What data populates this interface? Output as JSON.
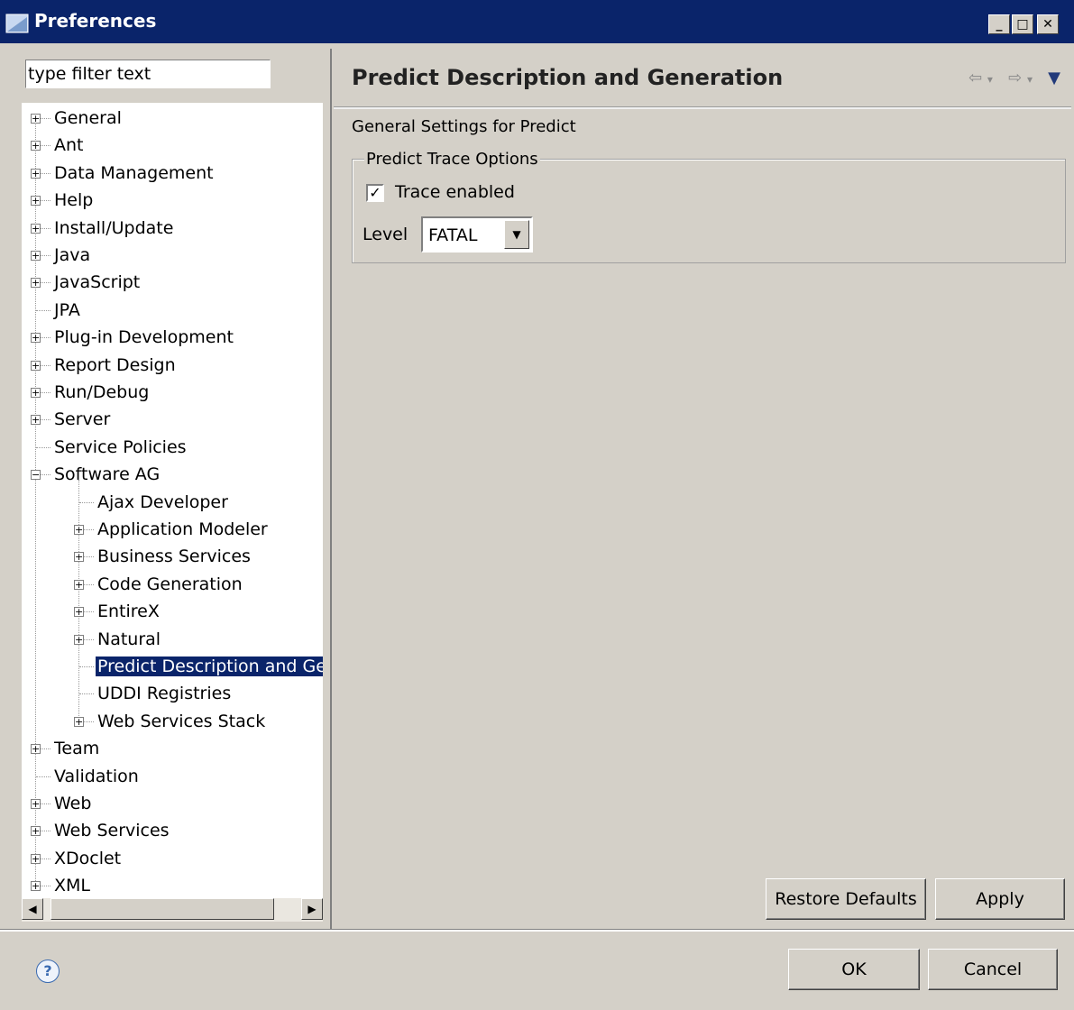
{
  "window": {
    "title": "Preferences"
  },
  "filter": {
    "placeholder": "type filter text",
    "value": "type filter text"
  },
  "tree": [
    {
      "label": "General",
      "expandable": true,
      "expanded": false,
      "level": 0
    },
    {
      "label": "Ant",
      "expandable": true,
      "expanded": false,
      "level": 0
    },
    {
      "label": "Data Management",
      "expandable": true,
      "expanded": false,
      "level": 0
    },
    {
      "label": "Help",
      "expandable": true,
      "expanded": false,
      "level": 0
    },
    {
      "label": "Install/Update",
      "expandable": true,
      "expanded": false,
      "level": 0
    },
    {
      "label": "Java",
      "expandable": true,
      "expanded": false,
      "level": 0
    },
    {
      "label": "JavaScript",
      "expandable": true,
      "expanded": false,
      "level": 0
    },
    {
      "label": "JPA",
      "expandable": false,
      "level": 0
    },
    {
      "label": "Plug-in Development",
      "expandable": true,
      "expanded": false,
      "level": 0
    },
    {
      "label": "Report Design",
      "expandable": true,
      "expanded": false,
      "level": 0
    },
    {
      "label": "Run/Debug",
      "expandable": true,
      "expanded": false,
      "level": 0
    },
    {
      "label": "Server",
      "expandable": true,
      "expanded": false,
      "level": 0
    },
    {
      "label": "Service Policies",
      "expandable": false,
      "level": 0
    },
    {
      "label": "Software AG",
      "expandable": true,
      "expanded": true,
      "level": 0
    },
    {
      "label": "Ajax Developer",
      "expandable": false,
      "level": 1
    },
    {
      "label": "Application Modeler",
      "expandable": true,
      "expanded": false,
      "level": 1
    },
    {
      "label": "Business Services",
      "expandable": true,
      "expanded": false,
      "level": 1
    },
    {
      "label": "Code Generation",
      "expandable": true,
      "expanded": false,
      "level": 1
    },
    {
      "label": "EntireX",
      "expandable": true,
      "expanded": false,
      "level": 1
    },
    {
      "label": "Natural",
      "expandable": true,
      "expanded": false,
      "level": 1
    },
    {
      "label": "Predict Description and Ger",
      "expandable": false,
      "level": 1,
      "selected": true
    },
    {
      "label": "UDDI Registries",
      "expandable": false,
      "level": 1
    },
    {
      "label": "Web Services Stack",
      "expandable": true,
      "expanded": false,
      "level": 1
    },
    {
      "label": "Team",
      "expandable": true,
      "expanded": false,
      "level": 0
    },
    {
      "label": "Validation",
      "expandable": false,
      "level": 0
    },
    {
      "label": "Web",
      "expandable": true,
      "expanded": false,
      "level": 0
    },
    {
      "label": "Web Services",
      "expandable": true,
      "expanded": false,
      "level": 0
    },
    {
      "label": "XDoclet",
      "expandable": true,
      "expanded": false,
      "level": 0
    },
    {
      "label": "XML",
      "expandable": true,
      "expanded": false,
      "level": 0
    }
  ],
  "page": {
    "title": "Predict Description and Generation",
    "section_title": "General Settings for Predict",
    "group_label": "Predict Trace Options",
    "trace_label": "Trace enabled",
    "trace_checked": true,
    "level_label": "Level",
    "level_value": "FATAL",
    "restore_defaults": "Restore Defaults",
    "apply": "Apply"
  },
  "dialog": {
    "ok": "OK",
    "cancel": "Cancel"
  },
  "colors": {
    "titlebar": "#0a246a",
    "background": "#d4d0c8",
    "selection": "#0a246a"
  }
}
